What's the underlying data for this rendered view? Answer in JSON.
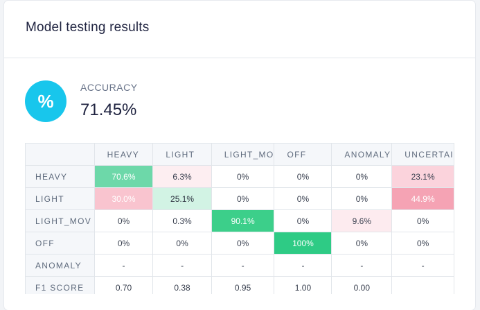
{
  "card": {
    "title": "Model testing results"
  },
  "accuracy": {
    "icon": "percent-icon",
    "icon_glyph": "%",
    "label": "ACCURACY",
    "value": "71.45%"
  },
  "matrix": {
    "columns": [
      "HEAVY",
      "LIGHT",
      "LIGHT_MO",
      "OFF",
      "ANOMALY",
      "UNCERTAI"
    ],
    "rows": [
      {
        "label": "HEAVY",
        "cells": [
          {
            "text": "70.6%",
            "bg": "#6dd8a9",
            "style": "bold"
          },
          {
            "text": "6.3%",
            "bg": "#fdeef1",
            "style": "normal"
          },
          {
            "text": "0%",
            "bg": "#ffffff",
            "style": "normal"
          },
          {
            "text": "0%",
            "bg": "#ffffff",
            "style": "normal"
          },
          {
            "text": "0%",
            "bg": "#ffffff",
            "style": "normal"
          },
          {
            "text": "23.1%",
            "bg": "#fbd3dc",
            "style": "normal"
          }
        ]
      },
      {
        "label": "LIGHT",
        "cells": [
          {
            "text": "30.0%",
            "bg": "#f9c4cf",
            "style": "bold"
          },
          {
            "text": "25.1%",
            "bg": "#d2f3e4",
            "style": "bold-dark"
          },
          {
            "text": "0%",
            "bg": "#ffffff",
            "style": "normal"
          },
          {
            "text": "0%",
            "bg": "#ffffff",
            "style": "normal"
          },
          {
            "text": "0%",
            "bg": "#ffffff",
            "style": "normal"
          },
          {
            "text": "44.9%",
            "bg": "#f5a3b4",
            "style": "bold"
          }
        ]
      },
      {
        "label": "LIGHT_MOV",
        "cells": [
          {
            "text": "0%",
            "bg": "#ffffff",
            "style": "normal"
          },
          {
            "text": "0.3%",
            "bg": "#ffffff",
            "style": "normal"
          },
          {
            "text": "90.1%",
            "bg": "#3ccf8a",
            "style": "bold"
          },
          {
            "text": "0%",
            "bg": "#ffffff",
            "style": "normal"
          },
          {
            "text": "9.6%",
            "bg": "#fdebef",
            "style": "normal"
          },
          {
            "text": "0%",
            "bg": "#ffffff",
            "style": "normal"
          }
        ]
      },
      {
        "label": "OFF",
        "cells": [
          {
            "text": "0%",
            "bg": "#ffffff",
            "style": "normal"
          },
          {
            "text": "0%",
            "bg": "#ffffff",
            "style": "normal"
          },
          {
            "text": "0%",
            "bg": "#ffffff",
            "style": "normal"
          },
          {
            "text": "100%",
            "bg": "#2ecb85",
            "style": "bold"
          },
          {
            "text": "0%",
            "bg": "#ffffff",
            "style": "normal"
          },
          {
            "text": "0%",
            "bg": "#ffffff",
            "style": "normal"
          }
        ]
      },
      {
        "label": "ANOMALY",
        "cells": [
          {
            "text": "-",
            "bg": "#ffffff",
            "style": "normal"
          },
          {
            "text": "-",
            "bg": "#ffffff",
            "style": "normal"
          },
          {
            "text": "-",
            "bg": "#ffffff",
            "style": "normal"
          },
          {
            "text": "-",
            "bg": "#ffffff",
            "style": "normal"
          },
          {
            "text": "-",
            "bg": "#ffffff",
            "style": "normal"
          },
          {
            "text": "-",
            "bg": "#ffffff",
            "style": "normal"
          }
        ]
      },
      {
        "label": "F1 SCORE",
        "cells": [
          {
            "text": "0.70",
            "bg": "#ffffff",
            "style": "normal"
          },
          {
            "text": "0.38",
            "bg": "#ffffff",
            "style": "normal"
          },
          {
            "text": "0.95",
            "bg": "#ffffff",
            "style": "normal"
          },
          {
            "text": "1.00",
            "bg": "#ffffff",
            "style": "normal"
          },
          {
            "text": "0.00",
            "bg": "#ffffff",
            "style": "normal"
          },
          {
            "text": "",
            "bg": "#ffffff",
            "style": "normal"
          }
        ]
      }
    ]
  }
}
